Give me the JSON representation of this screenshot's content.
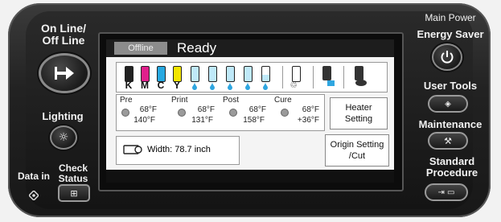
{
  "online_label": "On Line/\nOff Line",
  "lighting_label": "Lighting",
  "data_in_label": "Data in",
  "check_status_label": "Check\nStatus",
  "main_power_label": "Main Power",
  "energy_saver_label": "Energy Saver",
  "user_tools_label": "User Tools",
  "maintenance_label": "Maintenance",
  "standard_procedure_label": "Standard\nProcedure",
  "screen": {
    "mode_badge": "Offline",
    "status": "Ready",
    "inks": [
      {
        "label": "K",
        "color": "#222222"
      },
      {
        "label": "M",
        "color": "#e0208c"
      },
      {
        "label": "C",
        "color": "#27a8e0"
      },
      {
        "label": "Y",
        "color": "#f3e500"
      }
    ],
    "dry_heaters": {
      "pre": {
        "label": "Pre",
        "current": "68°F",
        "set": "140°F"
      },
      "print": {
        "label": "Print",
        "current": "68°F",
        "set": "131°F"
      },
      "post": {
        "label": "Post",
        "current": "68°F",
        "set": "158°F"
      },
      "cure": {
        "label": "Cure",
        "current": "68°F",
        "set": "+36°F"
      }
    },
    "heater_setting_label": "Heater\nSetting",
    "width_label": "Width: 78.7 inch",
    "origin_setting_label": "Origin Setting\n/Cut"
  }
}
